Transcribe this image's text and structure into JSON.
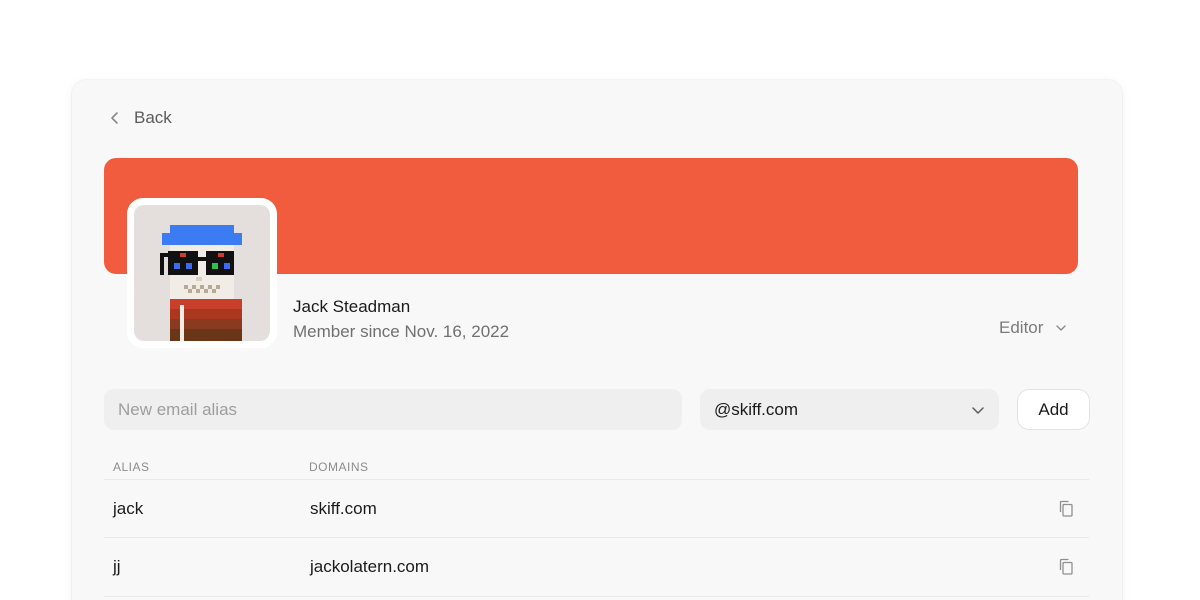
{
  "nav": {
    "back_label": "Back"
  },
  "colors": {
    "banner": "#f05c3d",
    "avatar_bg": "#e4dfdd",
    "hat": "#3b7cf2"
  },
  "profile": {
    "name": "Jack Steadman",
    "member_since": "Member since Nov. 16, 2022",
    "role": "Editor",
    "avatar_icon": "pixel-skull-avatar"
  },
  "alias_form": {
    "input_placeholder": "New email alias",
    "input_value": "",
    "domain_selected": "@skiff.com",
    "add_label": "Add"
  },
  "table": {
    "headers": {
      "alias": "ALIAS",
      "domains": "DOMAINS"
    },
    "rows": [
      {
        "alias": "jack",
        "domain": "skiff.com"
      },
      {
        "alias": "jj",
        "domain": "jackolatern.com"
      }
    ]
  }
}
